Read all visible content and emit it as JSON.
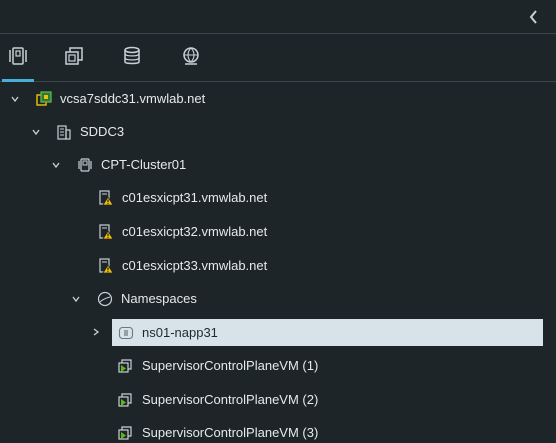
{
  "panel": {
    "collapse_icon": "chevron-left-icon"
  },
  "tabs": [
    {
      "name": "hosts-and-clusters",
      "icon": "hosts-clusters-icon"
    },
    {
      "name": "vms-and-templates",
      "icon": "vms-templates-icon"
    },
    {
      "name": "storage",
      "icon": "database-icon"
    },
    {
      "name": "networking",
      "icon": "globe-network-icon"
    }
  ],
  "tree": {
    "vcenter": {
      "label": "vcsa7sddc31.vmwlab.net",
      "icon": "vcenter-icon"
    },
    "datacenter": {
      "label": "SDDC3",
      "icon": "datacenter-icon"
    },
    "cluster": {
      "label": "CPT-Cluster01",
      "icon": "cluster-icon"
    },
    "hosts": [
      {
        "label": "c01esxicpt31.vmwlab.net",
        "icon": "host-warning-icon"
      },
      {
        "label": "c01esxicpt32.vmwlab.net",
        "icon": "host-warning-icon"
      },
      {
        "label": "c01esxicpt33.vmwlab.net",
        "icon": "host-warning-icon"
      }
    ],
    "namespaces": {
      "label": "Namespaces",
      "icon": "namespaces-icon"
    },
    "namespace": {
      "label": "ns01-napp31",
      "icon": "namespace-icon"
    },
    "vms": [
      {
        "label": "SupervisorControlPlaneVM (1)",
        "icon": "vm-running-icon"
      },
      {
        "label": "SupervisorControlPlaneVM (2)",
        "icon": "vm-running-icon"
      },
      {
        "label": "SupervisorControlPlaneVM (3)",
        "icon": "vm-running-icon"
      }
    ]
  },
  "colors": {
    "accent": "#49afd9",
    "selected_bg": "#d8e3e9",
    "warning": "#f5c000",
    "vm_green": "#5eb715"
  }
}
